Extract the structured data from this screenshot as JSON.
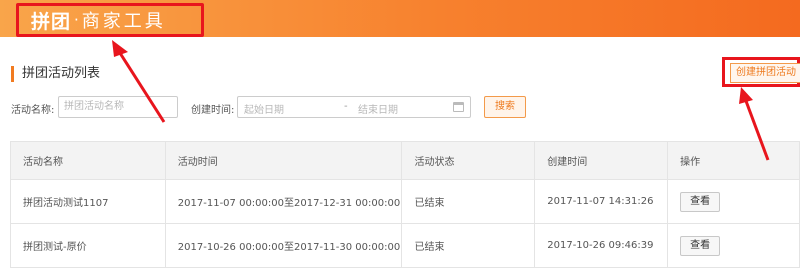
{
  "brand": {
    "part1": "拼团",
    "separator": "·",
    "part2": "商家工具"
  },
  "section_title": "拼团活动列表",
  "create_button": "创建拼团活动",
  "filters": {
    "name_label": "活动名称:",
    "name_placeholder": "拼团活动名称",
    "time_label": "创建时间:",
    "start_placeholder": "起始日期",
    "range_separator": "-",
    "end_placeholder": "结束日期",
    "search_button": "搜索"
  },
  "table": {
    "headers": [
      "活动名称",
      "活动时间",
      "活动状态",
      "创建时间",
      "操作"
    ],
    "rows": [
      {
        "name": "拼团活动测试1107",
        "period": "2017-11-07 00:00:00至2017-12-31 00:00:00",
        "status": "已结束",
        "created": "2017-11-07 14:31:26",
        "action": "查看"
      },
      {
        "name": "拼团测试-原价",
        "period": "2017-10-26 00:00:00至2017-11-30 00:00:00",
        "status": "已结束",
        "created": "2017-10-26 09:46:39",
        "action": "查看"
      }
    ]
  },
  "colors": {
    "accent": "#f17b21",
    "highlight": "#e8151d"
  }
}
